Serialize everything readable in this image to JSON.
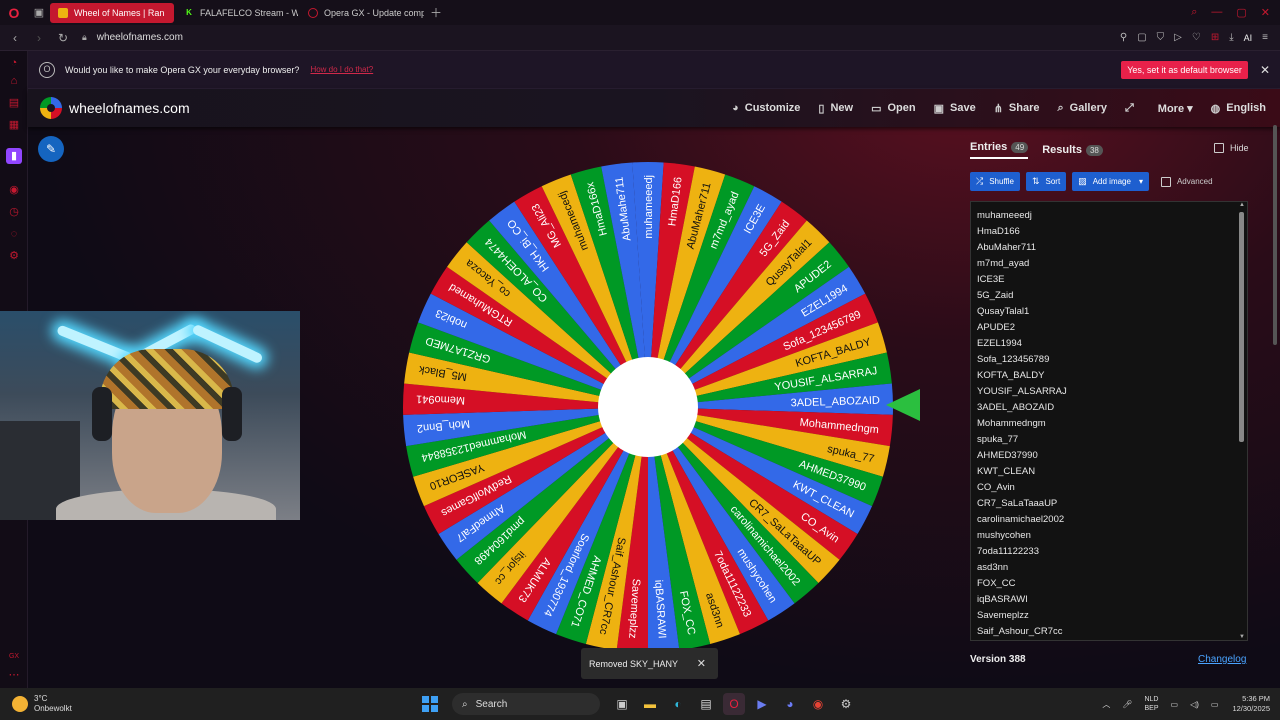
{
  "browser": {
    "tabs": [
      {
        "label": "Wheel of Names | Ran",
        "active": true
      },
      {
        "label": "FALAFELCO Stream - Wat",
        "active": false
      },
      {
        "label": "Opera GX - Update compl",
        "active": false
      }
    ],
    "url": "wheelofnames.com",
    "address_right_label": "AI"
  },
  "infobar": {
    "message": "Would you like to make Opera GX your everyday browser?",
    "how_to": "How do I do that?",
    "yes_button": "Yes, set it as default browser"
  },
  "site": {
    "title": "wheelofnames.com",
    "menu": [
      {
        "icon": "palette-icon",
        "glyph": "◕",
        "label": "Customize"
      },
      {
        "icon": "new-file-icon",
        "glyph": "▯",
        "label": "New"
      },
      {
        "icon": "folder-icon",
        "glyph": "▭",
        "label": "Open"
      },
      {
        "icon": "save-icon",
        "glyph": "▣",
        "label": "Save"
      },
      {
        "icon": "share-icon",
        "glyph": "⋔",
        "label": "Share"
      },
      {
        "icon": "search-icon",
        "glyph": "⌕",
        "label": "Gallery"
      },
      {
        "icon": "fullscreen-icon",
        "glyph": "⤢",
        "label": ""
      },
      {
        "icon": "more-icon",
        "glyph": "",
        "label": "More ▾"
      },
      {
        "icon": "globe-icon",
        "glyph": "◍",
        "label": "English"
      }
    ]
  },
  "wheel": {
    "colors": [
      "#3369e8",
      "#d50f25",
      "#eeb211",
      "#009925"
    ],
    "labels": [
      "muhameeedj",
      "HmaD166",
      "AbuMaher711",
      "m7md_ayad",
      "ICE3E",
      "5G_Zaid",
      "QusayTalal1",
      "APUDE2",
      "EZEL1994",
      "Sofa_123456789",
      "KOFTA_BALDY",
      "YOUSIF_ALSARRAJ",
      "3ADEL_ABOZAID",
      "Mohammedngm",
      "spuka_77",
      "AHMED37990",
      "KWT_CLEAN",
      "CO_Avin",
      "CR7_SaLaTaaaUP",
      "carolinamichael2002",
      "mushycohen",
      "7oda11122233",
      "asd3nn",
      "FOX_CC",
      "iqBASRAWI",
      "Savemeplzz",
      "Saif_Ashour_CR7cc",
      "AHMED_CO71",
      "Soarlord_1930774",
      "ALMUK73",
      "itsjor_cc",
      "pmd1604498",
      "AhmedFal7",
      "RedWolfGames",
      "YASEOR10",
      "Mohammed12358844",
      "Moh_Bnn2",
      "Memo941",
      "M5_Black",
      "GRZ1A7MED",
      "nobi23",
      "RTGMuhamed",
      "co_Yacoza",
      "CO_ALOEH4474",
      "HKH_Bi_CO",
      "MG_Ali23",
      "muhamecedj",
      "HmaD166x",
      "AbuMahe711"
    ]
  },
  "toast": {
    "message": "Removed SKY_HANY"
  },
  "panel": {
    "tabs": [
      {
        "label": "Entries",
        "count": "49"
      },
      {
        "label": "Results",
        "count": "38"
      }
    ],
    "hide_label": "Hide",
    "tools": {
      "shuffle": "Shuffle",
      "sort": "Sort",
      "add_image": "Add image",
      "advanced": "Advanced"
    },
    "entries": [
      "muhameeedj",
      "HmaD166",
      "AbuMaher711",
      "m7md_ayad",
      "ICE3E",
      "5G_Zaid",
      "QusayTalal1",
      "APUDE2",
      "EZEL1994",
      "Sofa_123456789",
      "KOFTA_BALDY",
      "YOUSIF_ALSARRAJ",
      "3ADEL_ABOZAID",
      "Mohammedngm",
      "spuka_77",
      "AHMED37990",
      "KWT_CLEAN",
      "CO_Avin",
      "CR7_SaLaTaaaUP",
      "carolinamichael2002",
      "mushycohen",
      "7oda11122233",
      "asd3nn",
      "FOX_CC",
      "iqBASRAWI",
      "Savemeplzz",
      "Saif_Ashour_CR7cc"
    ],
    "version": "Version 388",
    "changelog": "Changelog"
  },
  "taskbar": {
    "weather_temp": "3°C",
    "weather_desc": "Onbewolkt",
    "search_placeholder": "Search",
    "lang_top": "NLD",
    "lang_bottom": "BEP",
    "time": "5:36 PM",
    "date": "12/30/2025"
  }
}
